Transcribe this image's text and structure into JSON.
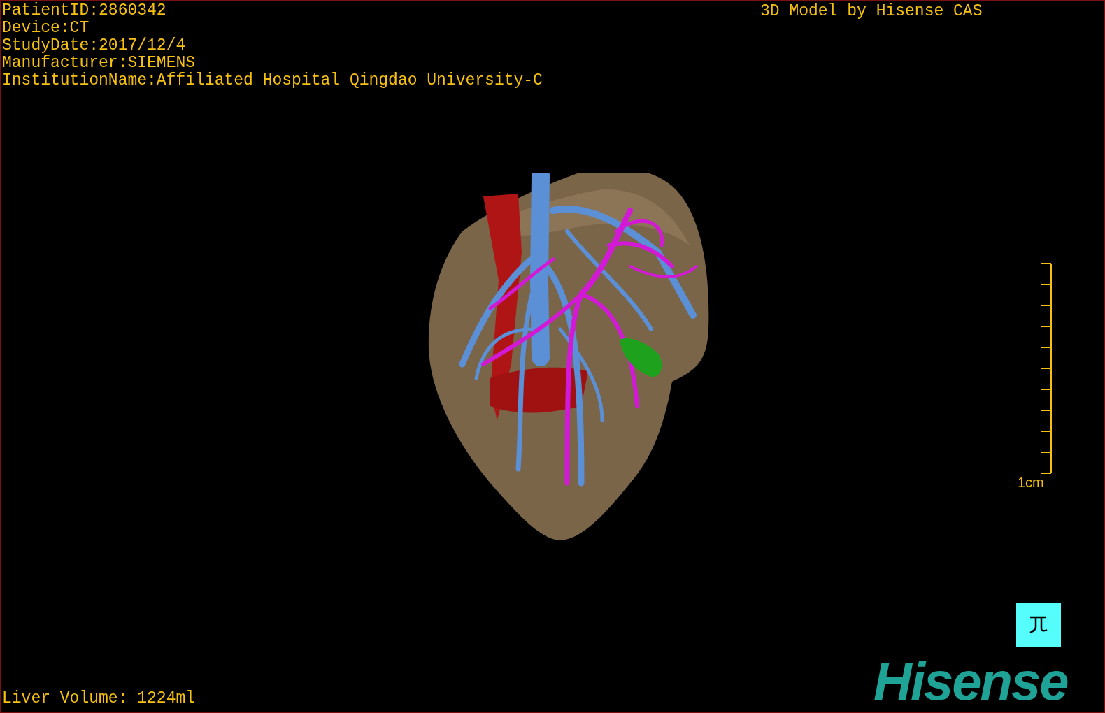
{
  "patient_info": [
    "PatientID:2860342",
    "Device:CT",
    "StudyDate:2017/12/4",
    "Manufacturer:SIEMENS",
    "InstitutionName:Affiliated Hospital Qingdao University-C"
  ],
  "title": "3D Model by Hisense CAS",
  "scale_bar": {
    "label": "1cm"
  },
  "liver_volume": "Liver Volume: 1224ml",
  "logo": "Hisense"
}
